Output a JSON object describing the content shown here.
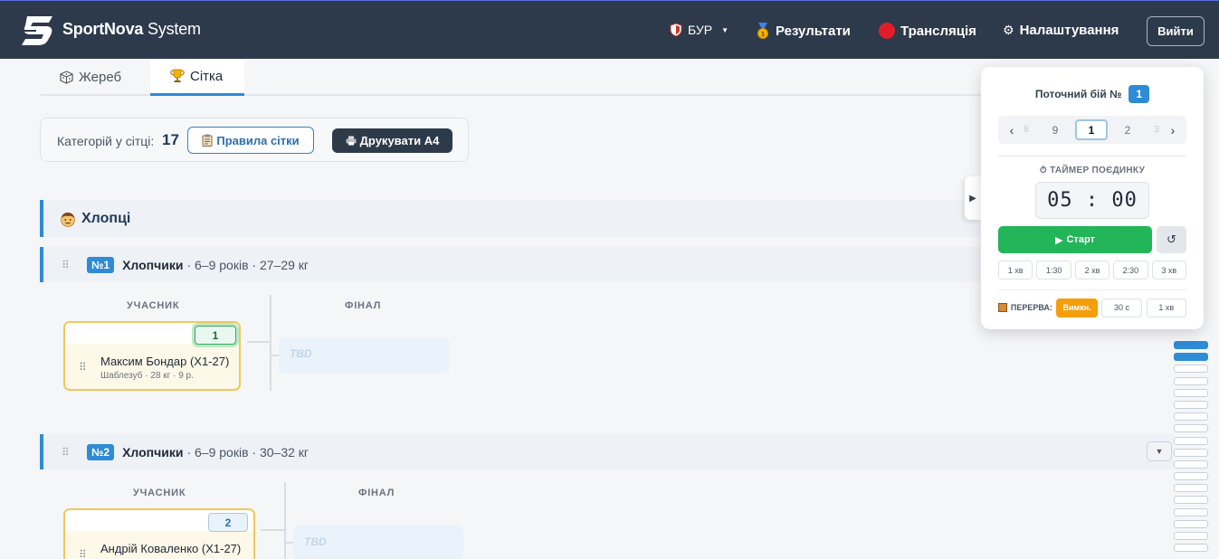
{
  "header": {
    "brand_bold": "SportNova",
    "brand_light": "System",
    "org_label": "БУР",
    "results_label": "Результати",
    "broadcast_label": "Трансляція",
    "settings_label": "Налаштування",
    "logout_label": "Вийти",
    "icons": [
      "logo-s-icon",
      "shield-icon",
      "medal-icon",
      "red-circle-icon",
      "gear-icon"
    ]
  },
  "tabs": [
    {
      "label": "Жереб",
      "icon": "dice-icon",
      "active": false
    },
    {
      "label": "Сітка",
      "icon": "trophy-icon",
      "active": true
    }
  ],
  "toolbar": {
    "categories_label": "Категорій у сітці:",
    "categories_count": "17",
    "rules_label": "Правила сітки",
    "print_label": "Друкувати А4"
  },
  "section": {
    "icon": "boy-face-icon",
    "title": "Хлопці"
  },
  "categories": [
    {
      "number": "№1",
      "title": "Хлопчики",
      "info": "· 6–9 років · 27–29 кг",
      "col_participant": "УЧАСНИК",
      "col_final": "ФІНАЛ",
      "participant": {
        "seed": "1",
        "name": "Максим Бондар (Х1-27)",
        "meta": "Шаблезуб · 28 кг · 9 р.",
        "active": true
      },
      "final_slot": "TBD"
    },
    {
      "number": "№2",
      "title": "Хлопчики",
      "info": "· 6–9 років · 30–32 кг",
      "col_participant": "УЧАСНИК",
      "col_final": "ФІНАЛ",
      "participant": {
        "seed": "2",
        "name": "Андрій Коваленко (Х1-27)",
        "meta": "",
        "active": false
      },
      "final_slot": "TBD"
    }
  ],
  "panel": {
    "current_fight_label": "Поточний бій №",
    "current_fight": "1",
    "fight_nav": {
      "prev_far": "8",
      "prev": "9",
      "current": "1",
      "next": "2",
      "next_far": "3"
    },
    "timer_label": "ТАЙМЕР ПОЄДИНКУ",
    "timer_value": "05 : 00",
    "start_label": "Старт",
    "presets": [
      "1 хв",
      "1:30",
      "2 хв",
      "2:30",
      "3 хв"
    ],
    "break_label": "ПЕРЕРВА:",
    "break_options": [
      "Вимкн.",
      "30 с",
      "1 хв"
    ],
    "break_selected": "Вимкн."
  },
  "markers": {
    "total": 18,
    "active": [
      0,
      1
    ]
  },
  "colors": {
    "header_bg": "#2c3a4b",
    "accent_blue": "#2e8bd6",
    "start_green": "#22b55a",
    "break_orange": "#f59e0b",
    "participant_border": "#f0c85a"
  }
}
